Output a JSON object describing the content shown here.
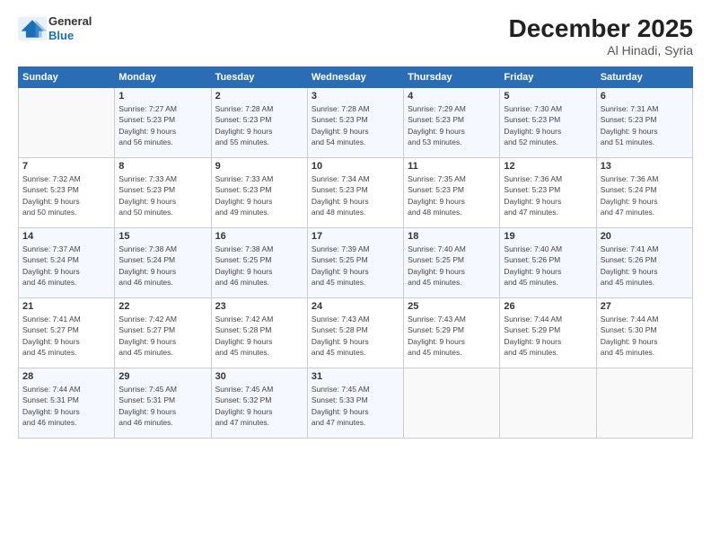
{
  "logo": {
    "line1": "General",
    "line2": "Blue"
  },
  "header": {
    "month": "December 2025",
    "location": "Al Hinadi, Syria"
  },
  "days_of_week": [
    "Sunday",
    "Monday",
    "Tuesday",
    "Wednesday",
    "Thursday",
    "Friday",
    "Saturday"
  ],
  "weeks": [
    [
      {
        "day": "",
        "info": ""
      },
      {
        "day": "1",
        "info": "Sunrise: 7:27 AM\nSunset: 5:23 PM\nDaylight: 9 hours\nand 56 minutes."
      },
      {
        "day": "2",
        "info": "Sunrise: 7:28 AM\nSunset: 5:23 PM\nDaylight: 9 hours\nand 55 minutes."
      },
      {
        "day": "3",
        "info": "Sunrise: 7:28 AM\nSunset: 5:23 PM\nDaylight: 9 hours\nand 54 minutes."
      },
      {
        "day": "4",
        "info": "Sunrise: 7:29 AM\nSunset: 5:23 PM\nDaylight: 9 hours\nand 53 minutes."
      },
      {
        "day": "5",
        "info": "Sunrise: 7:30 AM\nSunset: 5:23 PM\nDaylight: 9 hours\nand 52 minutes."
      },
      {
        "day": "6",
        "info": "Sunrise: 7:31 AM\nSunset: 5:23 PM\nDaylight: 9 hours\nand 51 minutes."
      }
    ],
    [
      {
        "day": "7",
        "info": "Sunrise: 7:32 AM\nSunset: 5:23 PM\nDaylight: 9 hours\nand 50 minutes."
      },
      {
        "day": "8",
        "info": "Sunrise: 7:33 AM\nSunset: 5:23 PM\nDaylight: 9 hours\nand 50 minutes."
      },
      {
        "day": "9",
        "info": "Sunrise: 7:33 AM\nSunset: 5:23 PM\nDaylight: 9 hours\nand 49 minutes."
      },
      {
        "day": "10",
        "info": "Sunrise: 7:34 AM\nSunset: 5:23 PM\nDaylight: 9 hours\nand 48 minutes."
      },
      {
        "day": "11",
        "info": "Sunrise: 7:35 AM\nSunset: 5:23 PM\nDaylight: 9 hours\nand 48 minutes."
      },
      {
        "day": "12",
        "info": "Sunrise: 7:36 AM\nSunset: 5:23 PM\nDaylight: 9 hours\nand 47 minutes."
      },
      {
        "day": "13",
        "info": "Sunrise: 7:36 AM\nSunset: 5:24 PM\nDaylight: 9 hours\nand 47 minutes."
      }
    ],
    [
      {
        "day": "14",
        "info": "Sunrise: 7:37 AM\nSunset: 5:24 PM\nDaylight: 9 hours\nand 46 minutes."
      },
      {
        "day": "15",
        "info": "Sunrise: 7:38 AM\nSunset: 5:24 PM\nDaylight: 9 hours\nand 46 minutes."
      },
      {
        "day": "16",
        "info": "Sunrise: 7:38 AM\nSunset: 5:25 PM\nDaylight: 9 hours\nand 46 minutes."
      },
      {
        "day": "17",
        "info": "Sunrise: 7:39 AM\nSunset: 5:25 PM\nDaylight: 9 hours\nand 45 minutes."
      },
      {
        "day": "18",
        "info": "Sunrise: 7:40 AM\nSunset: 5:25 PM\nDaylight: 9 hours\nand 45 minutes."
      },
      {
        "day": "19",
        "info": "Sunrise: 7:40 AM\nSunset: 5:26 PM\nDaylight: 9 hours\nand 45 minutes."
      },
      {
        "day": "20",
        "info": "Sunrise: 7:41 AM\nSunset: 5:26 PM\nDaylight: 9 hours\nand 45 minutes."
      }
    ],
    [
      {
        "day": "21",
        "info": "Sunrise: 7:41 AM\nSunset: 5:27 PM\nDaylight: 9 hours\nand 45 minutes."
      },
      {
        "day": "22",
        "info": "Sunrise: 7:42 AM\nSunset: 5:27 PM\nDaylight: 9 hours\nand 45 minutes."
      },
      {
        "day": "23",
        "info": "Sunrise: 7:42 AM\nSunset: 5:28 PM\nDaylight: 9 hours\nand 45 minutes."
      },
      {
        "day": "24",
        "info": "Sunrise: 7:43 AM\nSunset: 5:28 PM\nDaylight: 9 hours\nand 45 minutes."
      },
      {
        "day": "25",
        "info": "Sunrise: 7:43 AM\nSunset: 5:29 PM\nDaylight: 9 hours\nand 45 minutes."
      },
      {
        "day": "26",
        "info": "Sunrise: 7:44 AM\nSunset: 5:29 PM\nDaylight: 9 hours\nand 45 minutes."
      },
      {
        "day": "27",
        "info": "Sunrise: 7:44 AM\nSunset: 5:30 PM\nDaylight: 9 hours\nand 45 minutes."
      }
    ],
    [
      {
        "day": "28",
        "info": "Sunrise: 7:44 AM\nSunset: 5:31 PM\nDaylight: 9 hours\nand 46 minutes."
      },
      {
        "day": "29",
        "info": "Sunrise: 7:45 AM\nSunset: 5:31 PM\nDaylight: 9 hours\nand 46 minutes."
      },
      {
        "day": "30",
        "info": "Sunrise: 7:45 AM\nSunset: 5:32 PM\nDaylight: 9 hours\nand 47 minutes."
      },
      {
        "day": "31",
        "info": "Sunrise: 7:45 AM\nSunset: 5:33 PM\nDaylight: 9 hours\nand 47 minutes."
      },
      {
        "day": "",
        "info": ""
      },
      {
        "day": "",
        "info": ""
      },
      {
        "day": "",
        "info": ""
      }
    ]
  ]
}
